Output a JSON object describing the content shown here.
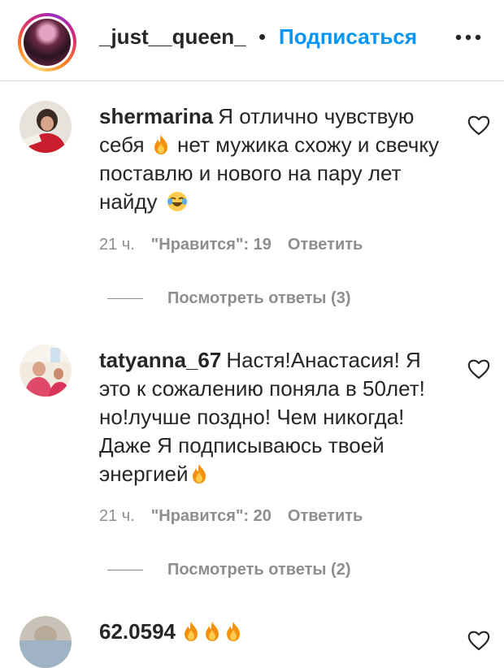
{
  "header": {
    "username": "_just__queen_",
    "separator": "•",
    "follow_label": "Подписаться",
    "more_icon": "ellipsis-icon"
  },
  "comments": [
    {
      "user": "shermarina",
      "text_parts": [
        "Я отлично чувствую себя",
        "нет мужика схожу и свечку поставлю и нового на пару лет найду"
      ],
      "time": "21 ч.",
      "likes": "\"Нравится\": 19",
      "reply_label": "Ответить",
      "view_replies": "Посмотреть ответы (3)"
    },
    {
      "user": "tatyanna_67",
      "text_parts": [
        "Настя!Анастасия! Я это к сожалению поняла в 50лет! но!лучше поздно! Чем никогда! Даже Я подписываюсь твоей энергией"
      ],
      "time": "21 ч.",
      "likes": "\"Нравится\": 20",
      "reply_label": "Ответить",
      "view_replies": "Посмотреть ответы (2)"
    },
    {
      "user": "62.0594",
      "text_parts": [
        ""
      ]
    }
  ],
  "colors": {
    "accent": "#0095f6",
    "secondary_text": "#8e8e8e",
    "primary_text": "#262626"
  }
}
